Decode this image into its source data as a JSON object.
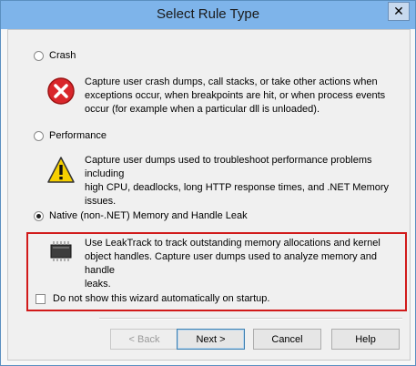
{
  "window": {
    "title": "Select Rule Type",
    "close_label": "✕"
  },
  "options": [
    {
      "label": "Crash",
      "selected": false,
      "description_lines": [
        "Capture user crash dumps, call stacks, or take other actions when",
        "exceptions occur, when breakpoints are hit, or when process events",
        "occur (for example when a particular dll is unloaded)."
      ],
      "icon": "error-icon"
    },
    {
      "label": "Performance",
      "selected": false,
      "description_lines": [
        "Capture user dumps used to troubleshoot performance problems including",
        "high CPU, deadlocks, long HTTP response times, and .NET Memory",
        "issues."
      ],
      "icon": "warning-icon"
    },
    {
      "label": "Native (non-.NET) Memory and Handle Leak",
      "selected": true,
      "description_lines": [
        "Use LeakTrack to track outstanding memory allocations and kernel",
        "object handles. Capture user dumps used to analyze memory and handle",
        "leaks."
      ],
      "icon": "memory-chip-icon"
    }
  ],
  "startup_checkbox": {
    "label": "Do not show this wizard automatically on startup.",
    "checked": false
  },
  "buttons": {
    "back": "< Back",
    "next": "Next >",
    "cancel": "Cancel",
    "help": "Help"
  },
  "colors": {
    "title_bar": "#7eb4ea",
    "highlight": "#d11a1a"
  }
}
